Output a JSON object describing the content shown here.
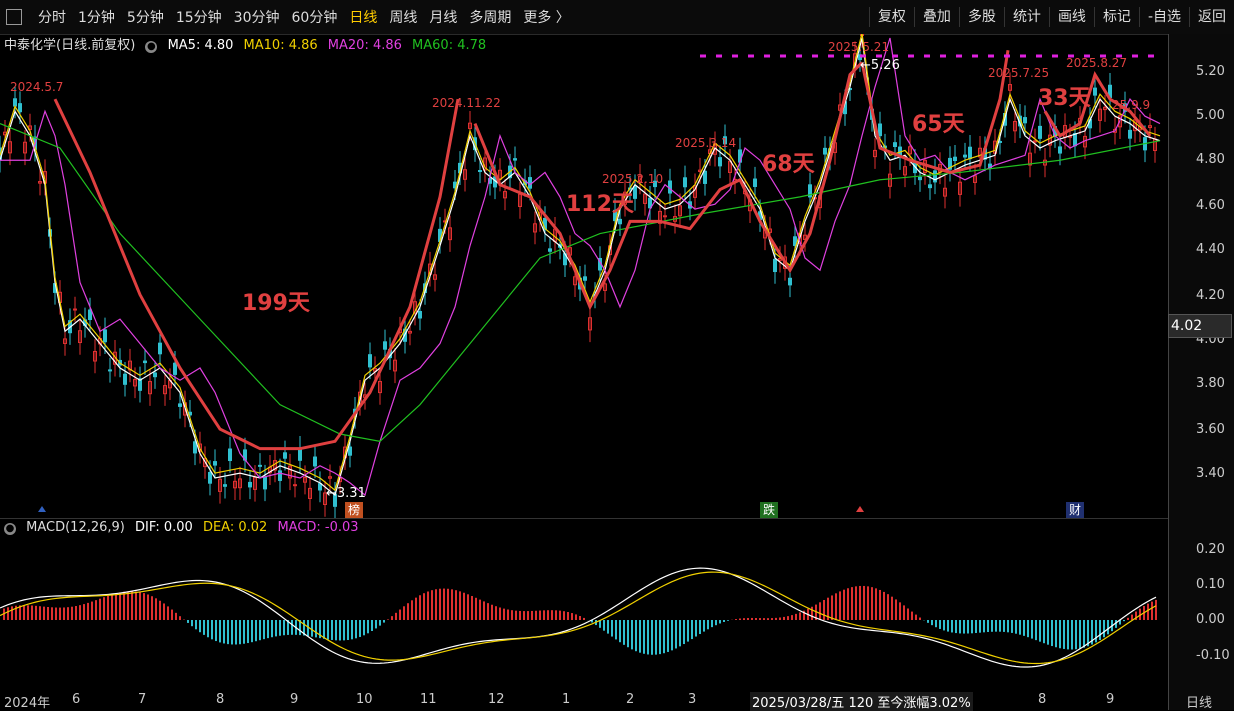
{
  "tabs": [
    {
      "label": "分时"
    },
    {
      "label": "1分钟"
    },
    {
      "label": "5分钟"
    },
    {
      "label": "15分钟"
    },
    {
      "label": "30分钟"
    },
    {
      "label": "60分钟"
    },
    {
      "label": "日线",
      "active": true
    },
    {
      "label": "周线"
    },
    {
      "label": "月线"
    },
    {
      "label": "多周期"
    },
    {
      "label": "更多 〉"
    }
  ],
  "right_buttons": [
    {
      "label": "复权"
    },
    {
      "label": "叠加"
    },
    {
      "label": "多股"
    },
    {
      "label": "统计"
    },
    {
      "label": "画线"
    },
    {
      "label": "标记"
    },
    {
      "label": "-自选"
    },
    {
      "label": "返回"
    }
  ],
  "stock": {
    "name": "中泰化学(日线.前复权)",
    "ma5": "MA5: 4.80",
    "ma10": "MA10: 4.86",
    "ma20": "MA20: 4.86",
    "ma60": "MA60: 4.78"
  },
  "price_axis": [
    "5.20",
    "5.00",
    "4.80",
    "4.60",
    "4.40",
    "4.20",
    "4.00",
    "3.80",
    "3.60",
    "3.40"
  ],
  "current_price": "4.02",
  "annotations": {
    "d1": "2024.5.7",
    "d2": "2024.11.22",
    "d3": "2025.2.10",
    "d4": "2025.3.14",
    "d5": "2025.5.21",
    "d6": "2025.7.25",
    "d7": "2025.8.27",
    "d8": "25.9.9",
    "n199": "199天",
    "n112": "112天",
    "n68": "68天",
    "n65": "65天",
    "n33": "33天",
    "low": "3.31",
    "high": "5.26"
  },
  "markers": {
    "bang": "榜",
    "die": "跌",
    "cai": "财"
  },
  "macd": {
    "title": "MACD(12,26,9)",
    "dif": "DIF: 0.00",
    "dea": "DEA: 0.02",
    "macd": "MACD: -0.03",
    "axis": [
      "0.20",
      "0.10",
      "0.00",
      "-0.10"
    ]
  },
  "time_axis": [
    "2024年",
    "6",
    "7",
    "8",
    "9",
    "10",
    "11",
    "12",
    "1",
    "2",
    "3",
    "8",
    "9"
  ],
  "crosshair_label": "2025/03/28/五 120 至今涨幅3.02%",
  "period_label": "日线",
  "colors": {
    "up": "#e03030",
    "down": "#30c0d0",
    "ma5": "#ffffff",
    "ma10": "#f0d000",
    "ma20": "#e040e0",
    "ma60": "#20c020",
    "annot": "#e04040"
  }
}
